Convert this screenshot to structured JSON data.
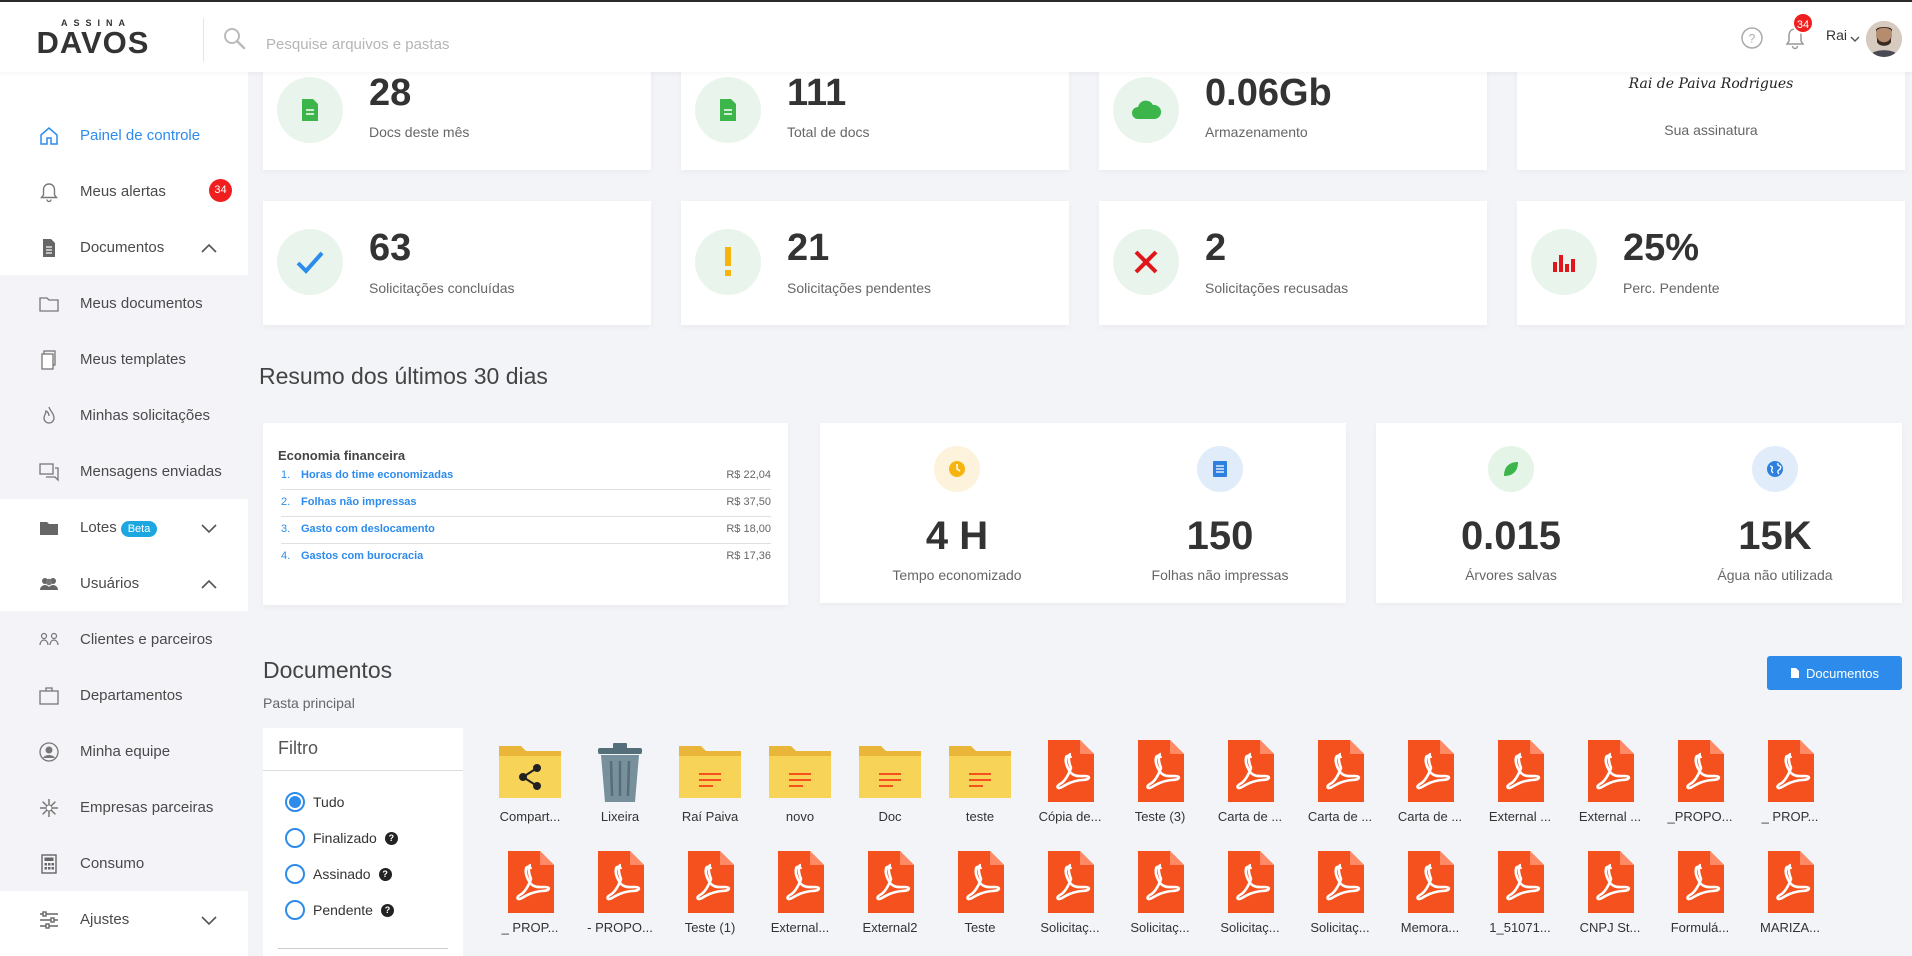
{
  "logo": {
    "top": "ASSINA",
    "main": "DAVOS"
  },
  "search": {
    "placeholder": "Pesquise arquivos e pastas"
  },
  "header": {
    "notification_count": "34",
    "user_name": "Rai"
  },
  "sidebar": {
    "items": [
      {
        "label": "Painel de controle",
        "icon": "home-icon",
        "active": true
      },
      {
        "label": "Meus alertas",
        "icon": "bell-icon",
        "badge": "34"
      },
      {
        "label": "Documentos",
        "icon": "document-icon",
        "chevron": "up"
      },
      {
        "label": "Meus documentos",
        "icon": "folder-icon",
        "sub": true
      },
      {
        "label": "Meus templates",
        "icon": "template-icon",
        "sub": true
      },
      {
        "label": "Minhas solicitações",
        "icon": "flame-icon",
        "sub": true
      },
      {
        "label": "Mensagens enviadas",
        "icon": "messages-icon",
        "sub": true
      },
      {
        "label": "Lotes",
        "icon": "folder-filled-icon",
        "tag": "Beta",
        "chevron": "down"
      },
      {
        "label": "Usuários",
        "icon": "users-icon",
        "chevron": "up"
      },
      {
        "label": "Clientes e parceiros",
        "icon": "clients-icon",
        "sub": true
      },
      {
        "label": "Departamentos",
        "icon": "briefcase-icon",
        "sub": true
      },
      {
        "label": "Minha equipe",
        "icon": "user-circle-icon",
        "sub": true
      },
      {
        "label": "Empresas parceiras",
        "icon": "starburst-icon",
        "sub": true
      },
      {
        "label": "Consumo",
        "icon": "calculator-icon",
        "sub": true
      },
      {
        "label": "Ajustes",
        "icon": "sliders-icon",
        "chevron": "down"
      }
    ]
  },
  "stats_row1": [
    {
      "value": "28",
      "label": "Docs deste mês",
      "icon": "doc-green-icon"
    },
    {
      "value": "111",
      "label": "Total de docs",
      "icon": "doc-green-icon"
    },
    {
      "value": "0.06Gb",
      "label": "Armazenamento",
      "icon": "cloud-icon"
    }
  ],
  "signature": {
    "text": "Rai de Paiva Rodrigues",
    "label": "Sua assinatura"
  },
  "stats_row2": [
    {
      "value": "63",
      "label": "Solicitações concluídas",
      "icon": "check-icon"
    },
    {
      "value": "21",
      "label": "Solicitações pendentes",
      "icon": "exclamation-icon"
    },
    {
      "value": "2",
      "label": "Solicitações recusadas",
      "icon": "x-icon"
    },
    {
      "value": "25%",
      "label": "Perc. Pendente",
      "icon": "bar-chart-icon"
    }
  ],
  "summary": {
    "title": "Resumo dos últimos 30 dias"
  },
  "finance": {
    "title": "Economia financeira",
    "rows": [
      {
        "num": "1.",
        "label": "Horas do time economizadas",
        "value": "R$ 22,04"
      },
      {
        "num": "2.",
        "label": "Folhas não impressas",
        "value": "R$ 37,50"
      },
      {
        "num": "3.",
        "label": "Gasto com deslocamento",
        "value": "R$ 18,00"
      },
      {
        "num": "4.",
        "label": "Gastos com burocracia",
        "value": "R$ 17,36"
      }
    ]
  },
  "metrics": [
    {
      "value": "4 H",
      "label": "Tempo economizado",
      "icon": "clock-icon",
      "color": "#f6b40e"
    },
    {
      "value": "150",
      "label": "Folhas não impressas",
      "icon": "paper-icon",
      "color": "#2d7fe0"
    },
    {
      "value": "0.015",
      "label": "Árvores salvas",
      "icon": "leaf-icon",
      "color": "#3cb54a"
    },
    {
      "value": "15K",
      "label": "Água não utilizada",
      "icon": "globe-icon",
      "color": "#2d7fe0"
    }
  ],
  "documents": {
    "title": "Documentos",
    "breadcrumb": "Pasta principal",
    "button": "Documentos"
  },
  "filter": {
    "title": "Filtro",
    "options": [
      {
        "label": "Tudo",
        "checked": true
      },
      {
        "label": "Finalizado",
        "help": "?"
      },
      {
        "label": "Assinado",
        "help": "?"
      },
      {
        "label": "Pendente",
        "help": "?"
      }
    ]
  },
  "files_row1": [
    {
      "name": "Compart...",
      "type": "shared-folder"
    },
    {
      "name": "Lixeira",
      "type": "trash"
    },
    {
      "name": "Raí Paiva",
      "type": "folder"
    },
    {
      "name": "novo",
      "type": "folder"
    },
    {
      "name": "Doc",
      "type": "folder"
    },
    {
      "name": "teste",
      "type": "folder"
    },
    {
      "name": "Cópia de...",
      "type": "pdf"
    },
    {
      "name": "Teste (3)",
      "type": "pdf"
    },
    {
      "name": "Carta de ...",
      "type": "pdf"
    },
    {
      "name": "Carta de ...",
      "type": "pdf"
    },
    {
      "name": "Carta de ...",
      "type": "pdf"
    },
    {
      "name": "External ...",
      "type": "pdf"
    },
    {
      "name": "External ...",
      "type": "pdf"
    },
    {
      "name": "_PROPO...",
      "type": "pdf"
    },
    {
      "name": "_ PROP...",
      "type": "pdf"
    }
  ],
  "files_row2": [
    {
      "name": "_ PROP...",
      "type": "pdf"
    },
    {
      "name": "- PROPO...",
      "type": "pdf"
    },
    {
      "name": "Teste (1)",
      "type": "pdf"
    },
    {
      "name": "External...",
      "type": "pdf"
    },
    {
      "name": "External2",
      "type": "pdf"
    },
    {
      "name": "Teste",
      "type": "pdf"
    },
    {
      "name": "Solicitaç...",
      "type": "pdf"
    },
    {
      "name": "Solicitaç...",
      "type": "pdf"
    },
    {
      "name": "Solicitaç...",
      "type": "pdf"
    },
    {
      "name": "Solicitaç...",
      "type": "pdf"
    },
    {
      "name": "Memora...",
      "type": "pdf"
    },
    {
      "name": "1_51071...",
      "type": "pdf"
    },
    {
      "name": "CNPJ St...",
      "type": "pdf"
    },
    {
      "name": "Formulá...",
      "type": "pdf"
    },
    {
      "name": "MARIZA...",
      "type": "pdf"
    }
  ],
  "colors": {
    "accent": "#2d8ceb",
    "badge": "#f01f1f",
    "pdf": "#f4511e",
    "folder": "#f2c94c",
    "green": "#3cb54a"
  }
}
